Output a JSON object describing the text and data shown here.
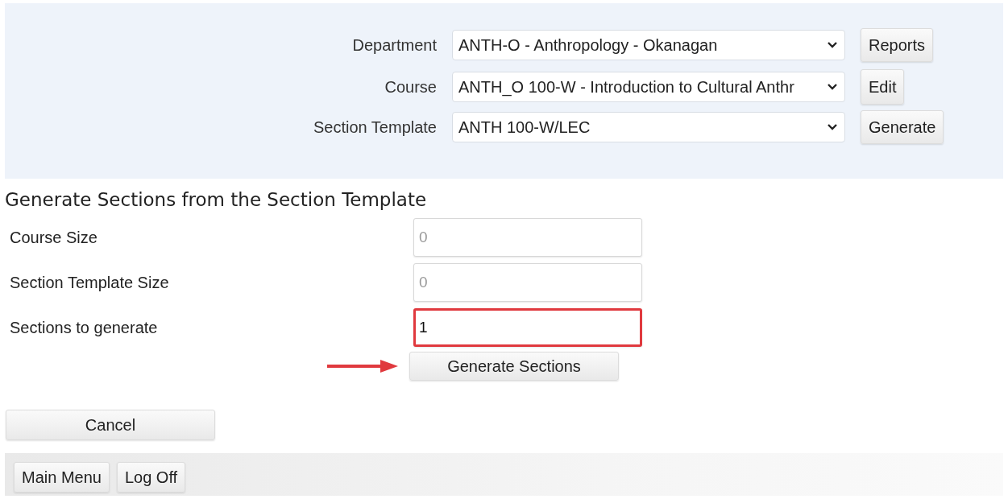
{
  "filters": [
    {
      "label": "Department",
      "value": "ANTH-O - Anthropology - Okanagan",
      "button": "Reports"
    },
    {
      "label": "Course",
      "value": "ANTH_O 100-W - Introduction to Cultural Anthr",
      "button": "Edit"
    },
    {
      "label": "Section Template",
      "value": "ANTH 100-W/LEC",
      "button": "Generate"
    }
  ],
  "heading": "Generate Sections from the Section Template",
  "fields": [
    {
      "label": "Course Size",
      "value": "0",
      "disabled": true,
      "highlighted": false
    },
    {
      "label": "Section Template Size",
      "value": "0",
      "disabled": true,
      "highlighted": false
    },
    {
      "label": "Sections to generate",
      "value": "1",
      "disabled": false,
      "highlighted": true
    }
  ],
  "generate_button": {
    "label": "Generate Sections",
    "pointed_at": true
  },
  "cancel_button": "Cancel",
  "footer_buttons": [
    "Main Menu",
    "Log Off"
  ]
}
